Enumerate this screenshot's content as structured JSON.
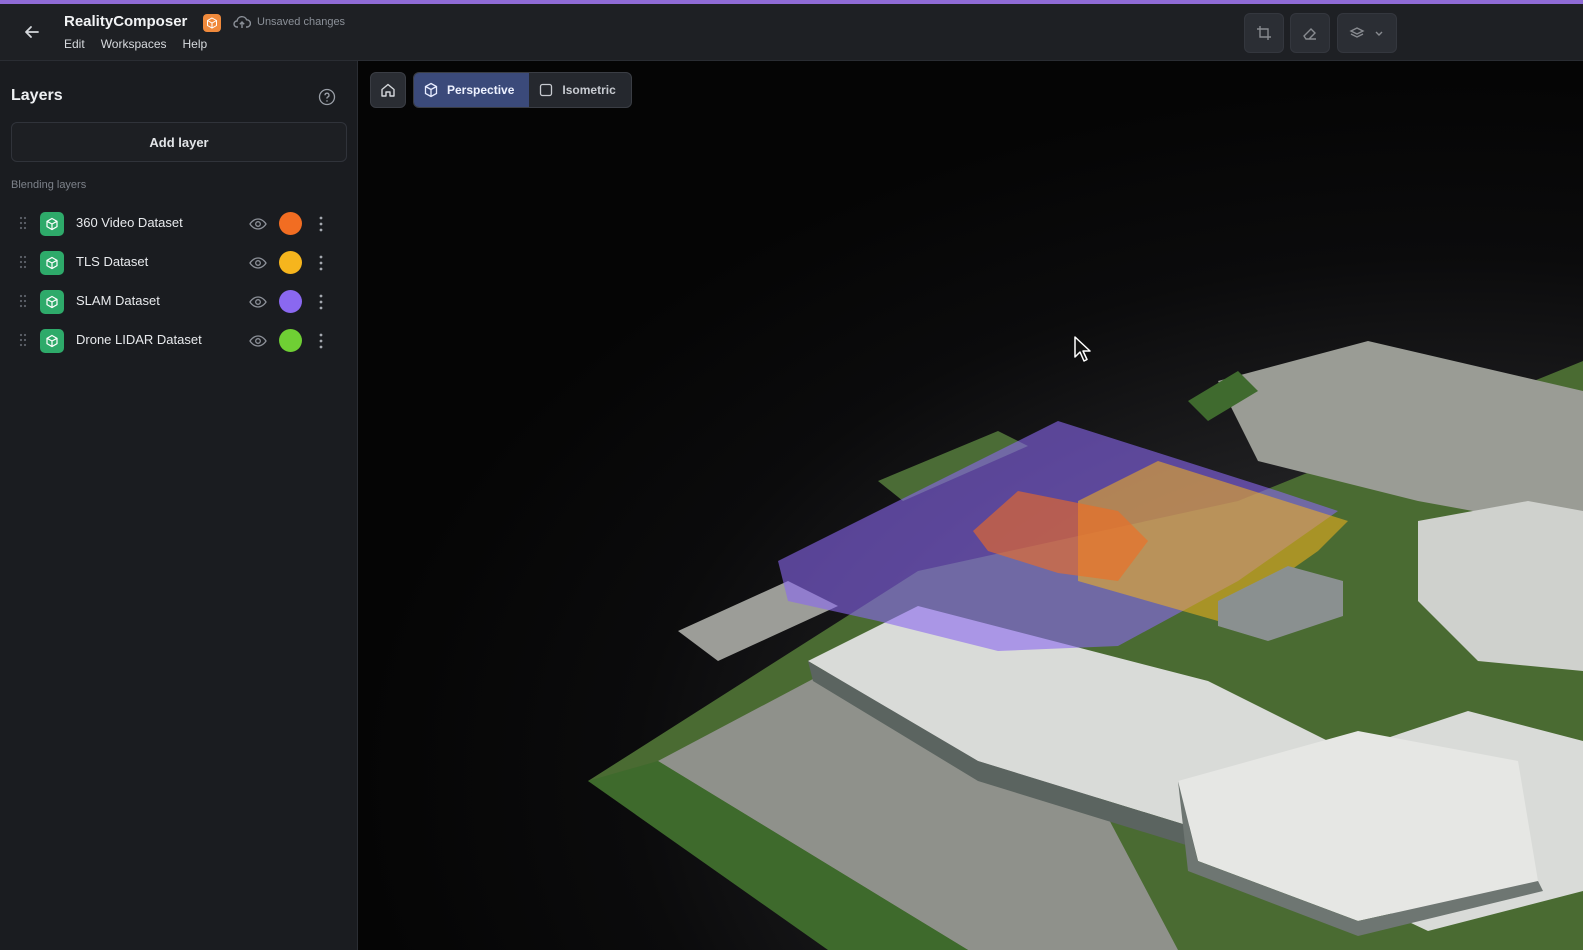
{
  "app": {
    "title": "RealityComposer",
    "status": "Unsaved changes",
    "menu": [
      "Edit",
      "Workspaces",
      "Help"
    ]
  },
  "sidebar": {
    "title": "Layers",
    "add_layer_label": "Add layer",
    "section_label": "Blending layers",
    "layers": [
      {
        "name": "360 Video Dataset",
        "color": "#f26d22"
      },
      {
        "name": "TLS Dataset",
        "color": "#f6b51d"
      },
      {
        "name": "SLAM Dataset",
        "color": "#8a68f0"
      },
      {
        "name": "Drone LIDAR Dataset",
        "color": "#6fcf34"
      }
    ]
  },
  "viewport": {
    "view_modes": [
      {
        "label": "Perspective",
        "active": true
      },
      {
        "label": "Isometric",
        "active": false
      }
    ]
  },
  "colors": {
    "accent_line": "#8f6bd6",
    "badge": "#f08a3c",
    "layer_icon": "#2eaa6a",
    "active_mode": "#3b4a7a"
  }
}
